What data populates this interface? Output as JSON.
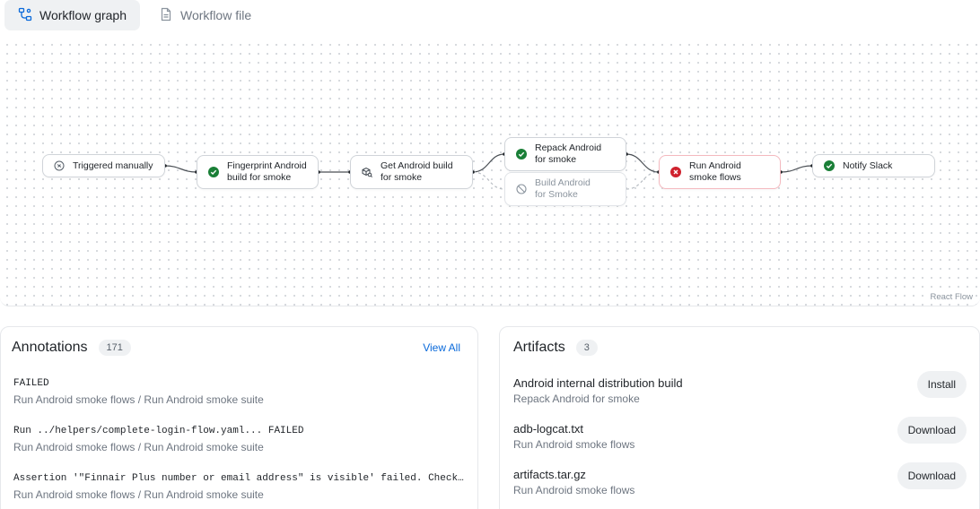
{
  "tabs": [
    {
      "label": "Workflow graph",
      "icon": "workflow-graph-icon",
      "active": true
    },
    {
      "label": "Workflow file",
      "icon": "file-icon",
      "active": false
    }
  ],
  "graph": {
    "attribution": "React Flow",
    "nodes": [
      {
        "line1": "Triggered manually",
        "line2": "",
        "status": "triggered"
      },
      {
        "line1": "Fingerprint Android",
        "line2": "build for smoke",
        "status": "success"
      },
      {
        "line1": "Get Android build",
        "line2": "for smoke",
        "status": "fetch"
      },
      {
        "line1": "Repack Android",
        "line2": "for smoke",
        "status": "success"
      },
      {
        "line1": "Build Android",
        "line2": "for Smoke",
        "status": "skipped"
      },
      {
        "line1": "Run Android",
        "line2": "smoke flows",
        "status": "failed"
      },
      {
        "line1": "Notify Slack",
        "line2": "",
        "status": "success"
      }
    ]
  },
  "colors": {
    "success": "#1a7f37",
    "failed": "#cf222e",
    "skipped": "#8b949e",
    "link": "#0969da"
  },
  "annotations": {
    "title": "Annotations",
    "count": "171",
    "view_all": "View All",
    "items": [
      {
        "message": "FAILED",
        "source": "Run Android smoke flows / Run Android smoke suite"
      },
      {
        "message": "Run ../helpers/complete-login-flow.yaml... FAILED",
        "source": "Run Android smoke flows / Run Android smoke suite"
      },
      {
        "message": "Assertion '\"Finnair Plus number or email address\" is visible' failed. Check the UI hierarchy in debug artifacts to verify the element state and properties.",
        "source": "Run Android smoke flows / Run Android smoke suite"
      }
    ]
  },
  "artifacts": {
    "title": "Artifacts",
    "count": "3",
    "items": [
      {
        "name": "Android internal distribution build",
        "source": "Repack Android for smoke",
        "action": "Install"
      },
      {
        "name": "adb-logcat.txt",
        "source": "Run Android smoke flows",
        "action": "Download"
      },
      {
        "name": "artifacts.tar.gz",
        "source": "Run Android smoke flows",
        "action": "Download"
      }
    ]
  }
}
